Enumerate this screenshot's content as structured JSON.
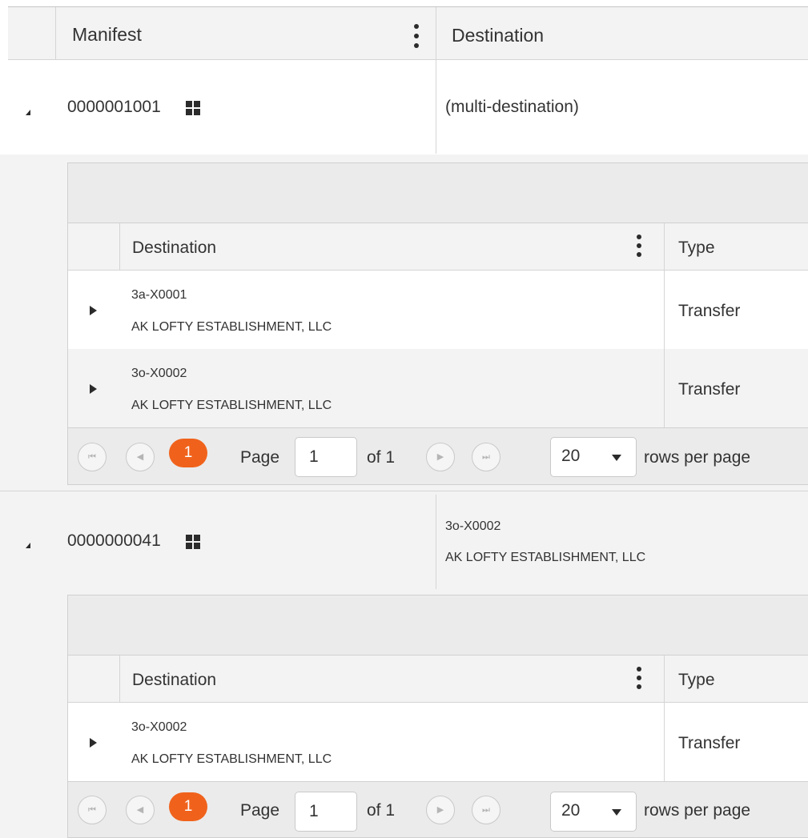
{
  "header": {
    "manifest_label": "Manifest",
    "destination_label": "Destination"
  },
  "master_rows": [
    {
      "manifest": "0000001001",
      "destination_single": "(multi-destination)",
      "detail": {
        "columns": {
          "destination": "Destination",
          "type": "Type"
        },
        "rows": [
          {
            "code": "3a-X0001",
            "name": "AK LOFTY ESTABLISHMENT, LLC",
            "type": "Transfer"
          },
          {
            "code": "3o-X0002",
            "name": "AK LOFTY ESTABLISHMENT, LLC",
            "type": "Transfer"
          }
        ],
        "pager": {
          "current_page": "1",
          "page_label": "Page",
          "page_input": "1",
          "of_label": "of 1",
          "page_size": "20",
          "rows_per_page_label": "rows per page"
        }
      }
    },
    {
      "manifest": "0000000041",
      "destination_code": "3o-X0002",
      "destination_name": "AK LOFTY ESTABLISHMENT, LLC",
      "detail": {
        "columns": {
          "destination": "Destination",
          "type": "Type"
        },
        "rows": [
          {
            "code": "3o-X0002",
            "name": "AK LOFTY ESTABLISHMENT, LLC",
            "type": "Transfer"
          }
        ],
        "pager": {
          "current_page": "1",
          "page_label": "Page",
          "page_input": "1",
          "of_label": "of 1",
          "page_size": "20",
          "rows_per_page_label": "rows per page"
        }
      }
    }
  ]
}
